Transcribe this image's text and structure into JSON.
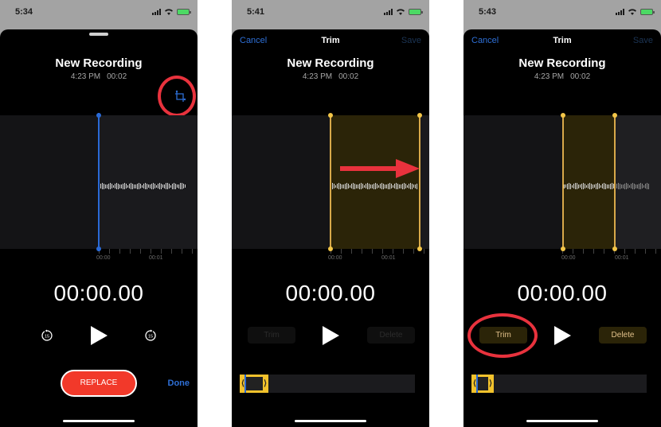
{
  "panels": [
    {
      "status_time": "5:34",
      "mode": "edit",
      "recording": {
        "title": "New Recording",
        "time": "4:23 PM",
        "duration": "00:02"
      },
      "icons": {
        "crop": "crop-trim-icon",
        "skip_back": "skip-back-15-icon",
        "play": "play-icon",
        "skip_forward": "skip-forward-15-icon"
      },
      "skip_seconds": "15",
      "timeline": {
        "tick_labels": [
          "00:00",
          "00:01"
        ]
      },
      "timer": "00:00.00",
      "replace_label": "REPLACE",
      "done_label": "Done",
      "annotation": "red circle around crop/trim icon"
    },
    {
      "status_time": "5:41",
      "mode": "trim",
      "nav": {
        "cancel": "Cancel",
        "title": "Trim",
        "save": "Save"
      },
      "recording": {
        "title": "New Recording",
        "time": "4:23 PM",
        "duration": "00:02"
      },
      "timeline": {
        "tick_labels": [
          "00:00",
          "00:01"
        ]
      },
      "timer": "00:00.00",
      "trim_label": "Trim",
      "delete_label": "Delete",
      "buttons_enabled": false,
      "annotation": "red arrow pointing right toward trim handle"
    },
    {
      "status_time": "5:43",
      "mode": "trim",
      "nav": {
        "cancel": "Cancel",
        "title": "Trim",
        "save": "Save"
      },
      "recording": {
        "title": "New Recording",
        "time": "4:23 PM",
        "duration": "00:02"
      },
      "timeline": {
        "tick_labels": [
          "00:00",
          "00:01"
        ]
      },
      "timer": "00:00.00",
      "trim_label": "Trim",
      "delete_label": "Delete",
      "buttons_enabled": true,
      "annotation": "red circle around Trim button"
    }
  ],
  "colors": {
    "accent_blue": "#2e6fd6",
    "trim_gold": "#f3c648",
    "replace_red": "#f2392a",
    "annotation_red": "#e8323d"
  }
}
